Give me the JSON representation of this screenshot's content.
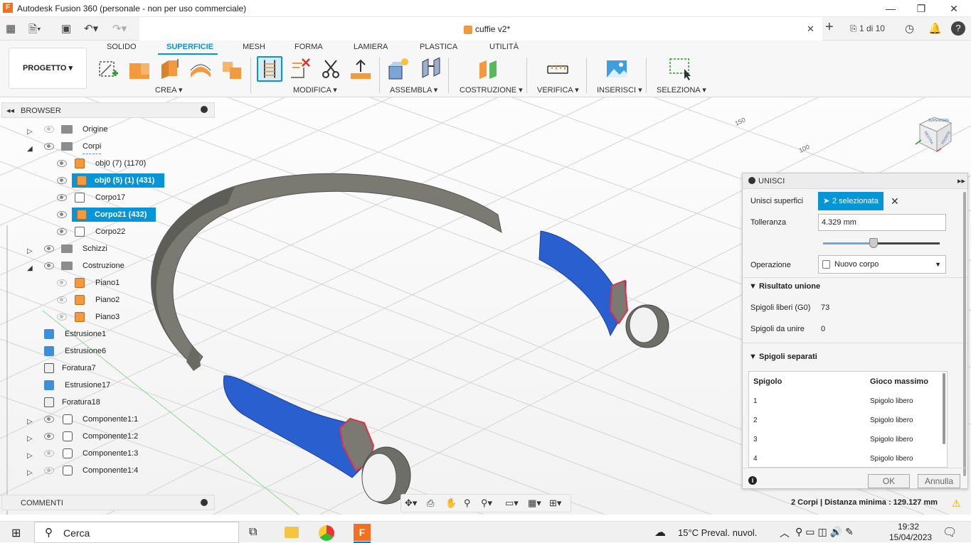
{
  "window": {
    "title": "Autodesk Fusion 360 (personale - non per uso commerciale)",
    "minimize": "—",
    "maximize": "❐",
    "close": "✕"
  },
  "doc_tabs": {
    "active_label": "cuffie v2*",
    "close": "✕",
    "new_tab": "+",
    "page_count": "1 di 10"
  },
  "ribbon": {
    "progetto": "PROGETTO ▾",
    "tabs": [
      "SOLIDO",
      "SUPERFICIE",
      "MESH",
      "FORMA",
      "LAMIERA",
      "PLASTICA",
      "UTILITÀ"
    ],
    "active_tab": "SUPERFICIE",
    "groups": [
      "CREA ▾",
      "MODIFICA ▾",
      "ASSEMBLA ▾",
      "COSTRUZIONE ▾",
      "VERIFICA ▾",
      "INSERISCI ▾",
      "SELEZIONA ▾"
    ]
  },
  "browser": {
    "title": "BROWSER",
    "rows": [
      {
        "label": "Origine"
      },
      {
        "label": "Corpi"
      },
      {
        "label": "obj0 (7) (1170)"
      },
      {
        "label": "obj0 (5) (1) (431)"
      },
      {
        "label": "Corpo17"
      },
      {
        "label": "Corpo21 (432)"
      },
      {
        "label": "Corpo22"
      },
      {
        "label": "Schizzi"
      },
      {
        "label": "Costruzione"
      },
      {
        "label": "Piano1"
      },
      {
        "label": "Piano2"
      },
      {
        "label": "Piano3"
      },
      {
        "label": "Estrusione1"
      },
      {
        "label": "Estrusione6"
      },
      {
        "label": "Foratura7"
      },
      {
        "label": "Estrusione17"
      },
      {
        "label": "Foratura18"
      },
      {
        "label": "Componente1:1"
      },
      {
        "label": "Componente1:2"
      },
      {
        "label": "Componente1:3"
      },
      {
        "label": "Componente1:4"
      }
    ]
  },
  "comments": {
    "title": "COMMENTI"
  },
  "viewcube": {
    "top": "SUPERIORE",
    "left": "DESTRA",
    "right": "FRONTE"
  },
  "dialog": {
    "title": "UNISCI",
    "unisci_label": "Unisci superfici",
    "selection": "2 selezionata",
    "tolleranza_label": "Tolleranza",
    "tolleranza_value": "4.329 mm",
    "tolerance_fraction": 0.43,
    "operazione_label": "Operazione",
    "operazione_value": "Nuovo corpo",
    "risultato_head": "Risultato unione",
    "spigoli_liberi_label": "Spigoli liberi (G0)",
    "spigoli_liberi_value": "73",
    "spigoli_unire_label": "Spigoli da unire",
    "spigoli_unire_value": "0",
    "spigoli_separati_head": "Spigoli separati",
    "table_headers": [
      "Spigolo",
      "Gioco massimo"
    ],
    "table_rows": [
      {
        "id": "1",
        "gap": "Spigolo libero"
      },
      {
        "id": "2",
        "gap": "Spigolo libero"
      },
      {
        "id": "3",
        "gap": "Spigolo libero"
      },
      {
        "id": "4",
        "gap": "Spigolo libero"
      }
    ],
    "ok": "OK",
    "annulla": "Annulla"
  },
  "status": {
    "info": "2 Corpi | Distanza minima : 129.127 mm"
  },
  "grid_labels": [
    "150",
    "100"
  ],
  "taskbar": {
    "search_placeholder": "Cerca",
    "weather": "15°C  Preval. nuvol.",
    "time": "19:32",
    "date": "15/04/2023"
  },
  "colors": {
    "accent": "#0696d7",
    "orange": "#f37021",
    "selected_body": "#2a5fd0",
    "band": "#7a7a72"
  }
}
